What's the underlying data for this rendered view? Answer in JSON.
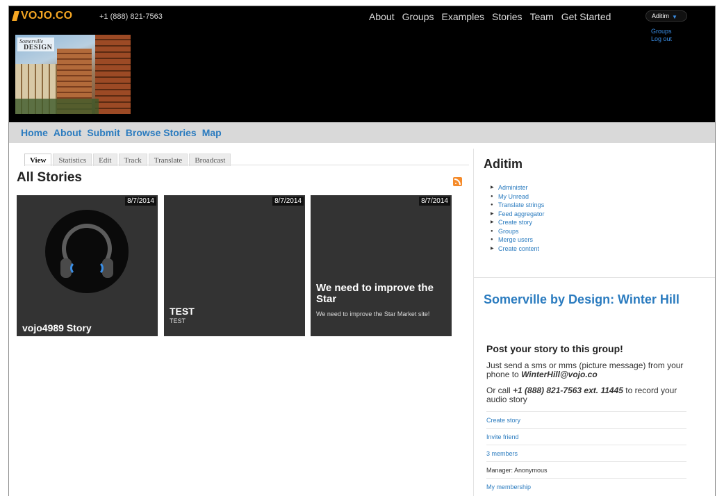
{
  "topbar": {
    "logo": "VOJO.CO",
    "phone": "+1 (888) 821-7563",
    "nav": [
      "About",
      "Groups",
      "Examples",
      "Stories",
      "Team",
      "Get Started"
    ],
    "user": "Aditim",
    "user_menu": [
      "Groups",
      "Log out"
    ]
  },
  "banner": {
    "image_text_1": "Somerville",
    "image_text_2": "DESIGN"
  },
  "subnav": [
    "Home",
    "About",
    "Submit",
    "Browse Stories",
    "Map"
  ],
  "tabs": [
    "View",
    "Statistics",
    "Edit",
    "Track",
    "Translate",
    "Broadcast"
  ],
  "main": {
    "title": "All Stories",
    "stories": [
      {
        "date": "8/7/2014",
        "title": "vojo4989 Story",
        "subtitle": ""
      },
      {
        "date": "8/7/2014",
        "title": "TEST",
        "subtitle": "TEST"
      },
      {
        "date": "8/7/2014",
        "title": "We need to improve the Star",
        "subtitle": "We need to improve the Star Market site!"
      }
    ]
  },
  "sidebar": {
    "user_name": "Aditim",
    "user_links": [
      "Administer",
      "My Unread",
      "Translate strings",
      "Feed aggregator",
      "Create story",
      "Groups",
      "Merge users",
      "Create content"
    ],
    "group": {
      "title": "Somerville by Design: Winter Hill",
      "post_heading": "Post your story to this group!",
      "sms_text": "Just send a sms or mms (picture message) from your phone to",
      "sms_email": "WinterHill@vojo.co",
      "call_prefix": "Or call",
      "call_number": "+1 (888) 821-7563 ext. 11445",
      "call_suffix": "to record your audio story",
      "links": [
        "Create story",
        "Invite friend",
        "3 members",
        "Manager: Anonymous",
        "My membership"
      ]
    }
  },
  "colors": {
    "accent_orange": "#f5a623",
    "link_blue": "#2a7bbf",
    "card_bg": "#333333",
    "rss_orange": "#f58b2b"
  }
}
